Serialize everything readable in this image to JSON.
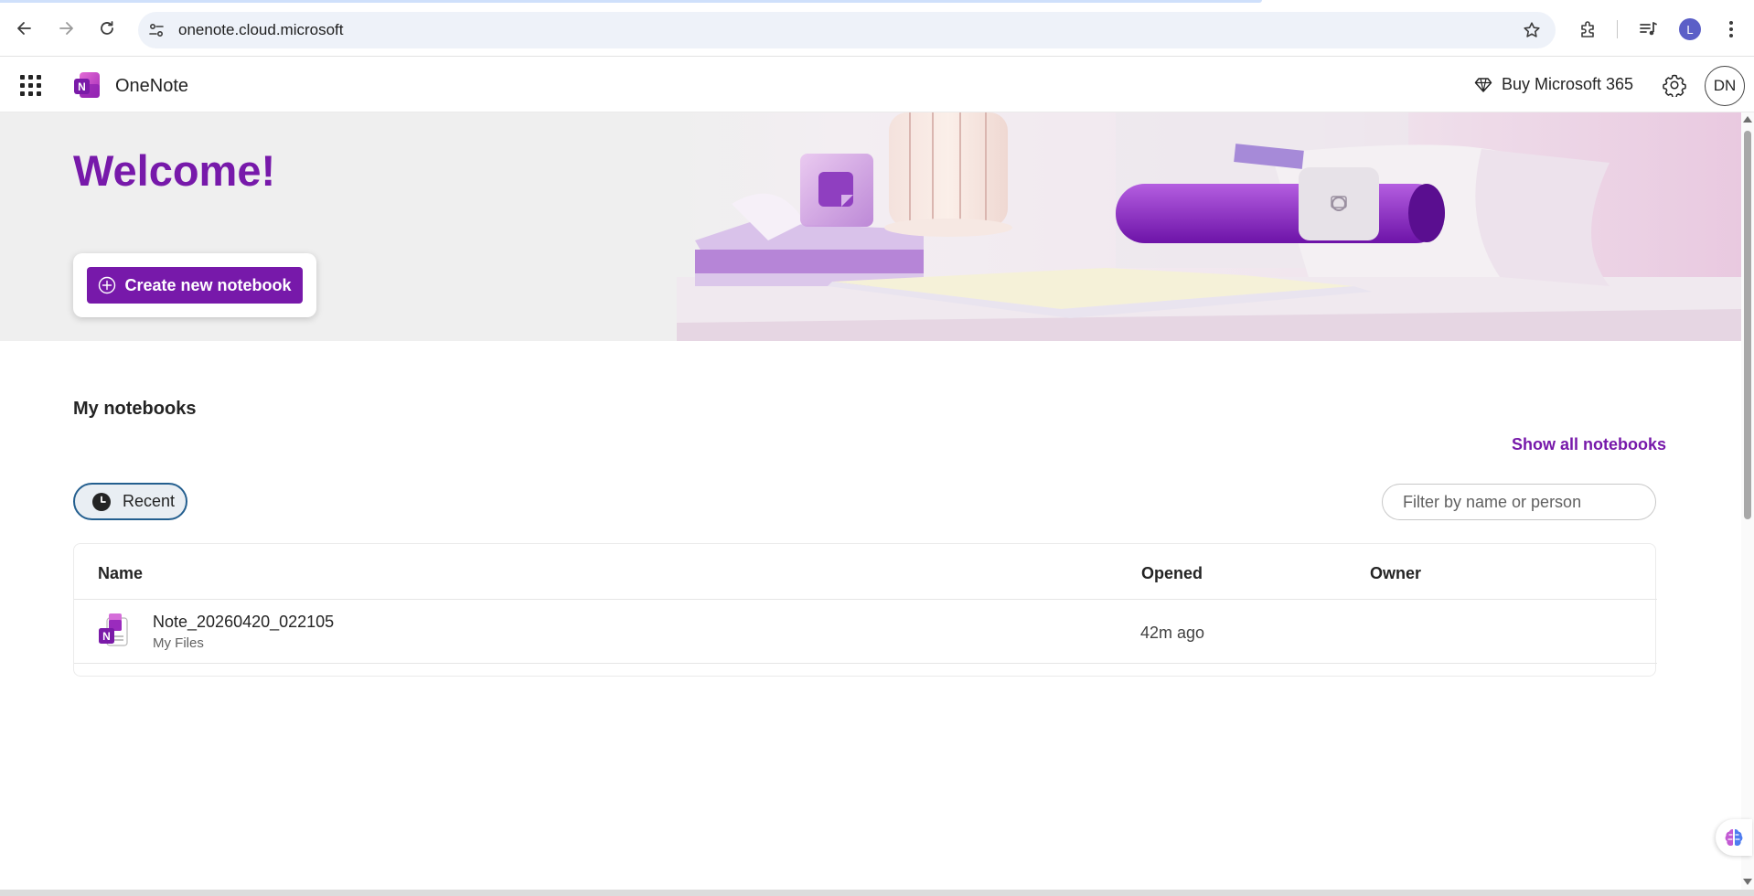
{
  "browser": {
    "url": "onenote.cloud.microsoft",
    "profile_initial": "L",
    "icons": [
      "back-arrow-icon",
      "forward-arrow-icon",
      "reload-icon",
      "site-info-icon",
      "star-icon",
      "extensions-icon",
      "media-icon",
      "kebab-menu-icon"
    ]
  },
  "app": {
    "name": "OneNote",
    "buy_label": "Buy Microsoft 365",
    "user_initials": "DN",
    "accent_color": "#7719aa"
  },
  "hero": {
    "title": "Welcome!",
    "create_label": "Create new notebook"
  },
  "notebooks": {
    "section_title": "My notebooks",
    "show_all_label": "Show all notebooks",
    "filter_tab_label": "Recent",
    "filter_placeholder": "Filter by name or person",
    "columns": {
      "name": "Name",
      "opened": "Opened",
      "owner": "Owner"
    },
    "rows": [
      {
        "name": "Note_20260420_022105",
        "location": "My Files",
        "opened": "42m ago",
        "owner": ""
      }
    ]
  }
}
